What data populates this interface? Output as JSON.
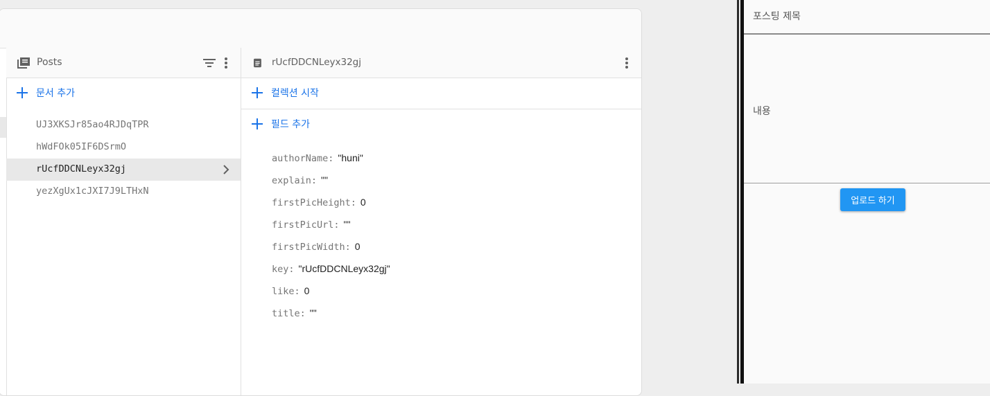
{
  "colors": {
    "accent": "#1a73e8",
    "button": "#2196f3"
  },
  "posts_column": {
    "title": "Posts",
    "add_document_label": "문서 추가",
    "documents": [
      {
        "id": "UJ3XKSJr85ao4RJDqTPR",
        "selected": false
      },
      {
        "id": "hWdFOk05IF6DSrmO",
        "selected": false
      },
      {
        "id": "rUcfDDCNLeyx32gj",
        "selected": true
      },
      {
        "id": "yezXgUx1cJXI7J9LTHxN",
        "selected": false
      }
    ]
  },
  "document_column": {
    "title": "rUcfDDCNLeyx32gj",
    "start_collection_label": "컬렉션 시작",
    "add_field_label": "필드 추가",
    "fields": [
      {
        "key": "authorName:",
        "value": "\"huni\""
      },
      {
        "key": "explain:",
        "value": "\"\""
      },
      {
        "key": "firstPicHeight:",
        "value": "0"
      },
      {
        "key": "firstPicUrl:",
        "value": "\"\""
      },
      {
        "key": "firstPicWidth:",
        "value": "0"
      },
      {
        "key": "key:",
        "value": "\"rUcfDDCNLeyx32gj\""
      },
      {
        "key": "like:",
        "value": "0"
      },
      {
        "key": "title:",
        "value": "\"\""
      }
    ]
  },
  "app": {
    "title_placeholder": "포스팅 제목",
    "content_placeholder": "내용",
    "upload_button_label": "업로드 하기"
  }
}
